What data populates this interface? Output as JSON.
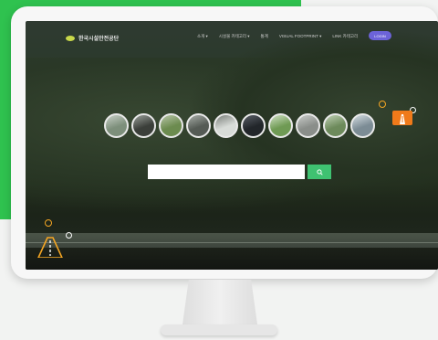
{
  "site": {
    "logo_text": "한국시설안전공단"
  },
  "nav": {
    "items": [
      "소개 ▾",
      "시설물 카테고리 ▾",
      "통계",
      "VISUAL FOOTPRINT ▾",
      "LINK 카테고리"
    ],
    "login_label": "LOGIN"
  },
  "thumbnails": [
    {
      "name": "bridge-view",
      "color_a": "#7d8f7b",
      "color_b": "#c8d0c7"
    },
    {
      "name": "tunnel-view",
      "color_a": "#3b3f3a",
      "color_b": "#9aa09a"
    },
    {
      "name": "forest-road",
      "color_a": "#6c8b4f",
      "color_b": "#b8c6a8"
    },
    {
      "name": "road-curve",
      "color_a": "#555b55",
      "color_b": "#a8aea8"
    },
    {
      "name": "tunnel-white",
      "color_a": "#d8dcd8",
      "color_b": "#7b807b"
    },
    {
      "name": "dark-tunnel",
      "color_a": "#22262a",
      "color_b": "#5b6068"
    },
    {
      "name": "green-trees",
      "color_a": "#6f9a54",
      "color_b": "#cfe0c3"
    },
    {
      "name": "gray-structure",
      "color_a": "#8a8e8a",
      "color_b": "#c9ccc9"
    },
    {
      "name": "mountain-bridge",
      "color_a": "#6d8a5b",
      "color_b": "#bfd0b4"
    },
    {
      "name": "highway",
      "color_a": "#7c8c95",
      "color_b": "#d5dde2"
    }
  ],
  "search": {
    "placeholder": "",
    "value": "",
    "button_icon": "search-icon"
  },
  "colors": {
    "accent_green": "#3fc271",
    "login_purple": "#6c63d8",
    "deco_orange": "#f5a623"
  }
}
